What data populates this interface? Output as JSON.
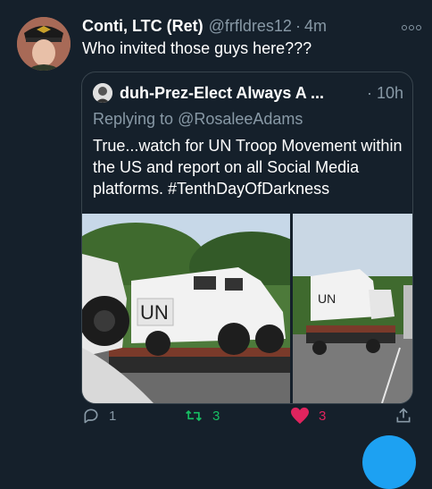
{
  "tweet": {
    "display_name": "Conti, LTC (Ret)",
    "handle": "@frfldres12",
    "separator": "·",
    "time": "4m",
    "text": "Who invited those guys here???",
    "avatar_icon": "profile-avatar"
  },
  "quoted_tweet": {
    "display_name": "duh-Prez-Elect Always A ...",
    "separator": "·",
    "time": "10h",
    "replying_prefix": "Replying to",
    "replying_to": "@RosaleeAdams",
    "text": "True...watch for UN Troop Movement within the US and report on all Social Media platforms. #TenthDayOfDarkness",
    "images": [
      "un-armored-truck-on-flatbed-close",
      "un-armored-trucks-on-flatbed-highway"
    ]
  },
  "actions": {
    "reply_count": "1",
    "retweet_count": "3",
    "like_count": "3",
    "icons": [
      "reply-icon",
      "retweet-icon",
      "heart-icon",
      "share-icon"
    ]
  },
  "colors": {
    "background": "#15202b",
    "secondary_text": "#8899a6",
    "retweet_green": "#17bf63",
    "like_red": "#e0245e",
    "accent_blue": "#1da1f2"
  }
}
